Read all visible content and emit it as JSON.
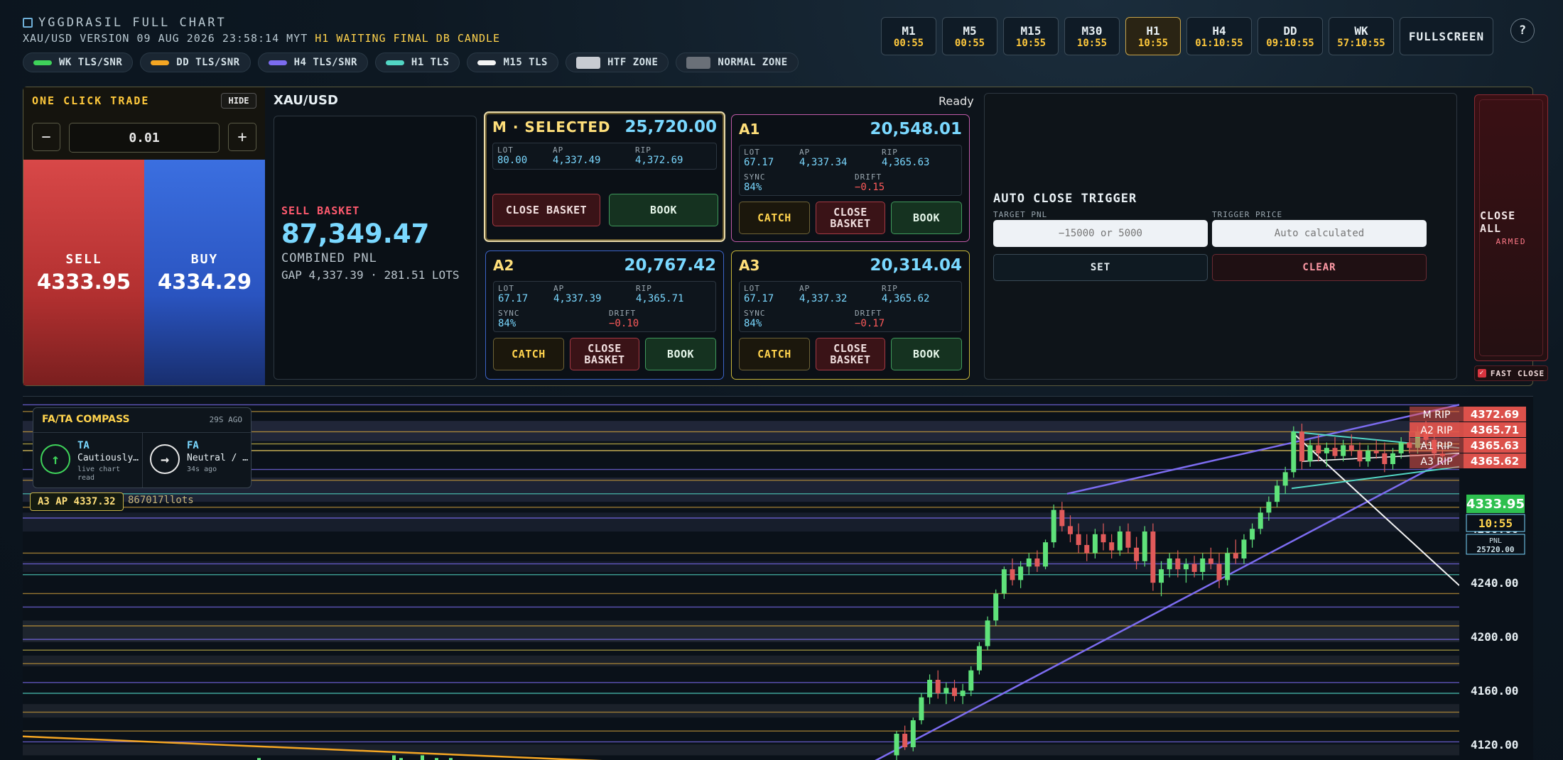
{
  "header": {
    "title": "YGGDRASIL FULL CHART",
    "sub_left": "XAU/USD VERSION 09 AUG 2026 23:58:14 MYT",
    "sub_highlight": "H1 WAITING FINAL DB CANDLE"
  },
  "legend": [
    {
      "label": "WK TLS/SNR",
      "color": "#3fd35a",
      "kind": "line"
    },
    {
      "label": "DD TLS/SNR",
      "color": "#f5a623",
      "kind": "line"
    },
    {
      "label": "H4 TLS/SNR",
      "color": "#7c6cf0",
      "kind": "line"
    },
    {
      "label": "H1 TLS",
      "color": "#52d6c4",
      "kind": "line"
    },
    {
      "label": "M15 TLS",
      "color": "#f4f4f4",
      "kind": "line"
    },
    {
      "label": "HTF ZONE",
      "color": "#c8ccd2",
      "kind": "box"
    },
    {
      "label": "NORMAL ZONE",
      "color": "#6a7078",
      "kind": "box"
    }
  ],
  "timeframes": [
    {
      "name": "M1",
      "timer": "00:55",
      "active": false
    },
    {
      "name": "M5",
      "timer": "00:55",
      "active": false
    },
    {
      "name": "M15",
      "timer": "10:55",
      "active": false
    },
    {
      "name": "M30",
      "timer": "10:55",
      "active": false
    },
    {
      "name": "H1",
      "timer": "10:55",
      "active": true
    },
    {
      "name": "H4",
      "timer": "01:10:55",
      "active": false
    },
    {
      "name": "DD",
      "timer": "09:10:55",
      "active": false
    },
    {
      "name": "WK",
      "timer": "57:10:55",
      "active": false
    }
  ],
  "fullscreen_label": "FULLSCREEN",
  "help_label": "?",
  "oct": {
    "title": "ONE CLICK TRADE",
    "hide_label": "HIDE",
    "minus": "−",
    "plus": "+",
    "lot": "0.01",
    "sell_label": "SELL",
    "sell_price": "4333.95",
    "buy_label": "BUY",
    "buy_price": "4334.29"
  },
  "symbol": "XAU/USD",
  "status": "Ready",
  "sell_basket": {
    "label": "SELL BASKET",
    "value": "87,349.47",
    "combined": "COMBINED PNL",
    "gap": "GAP 4,337.39 · 281.51 LOTS"
  },
  "accounts": {
    "m": {
      "name": "M · SELECTED",
      "value": "25,720.00",
      "lot": "80.00",
      "ap": "4,337.49",
      "rip": "4,372.69"
    },
    "a1": {
      "name": "A1",
      "value": "20,548.01",
      "lot": "67.17",
      "ap": "4,337.34",
      "rip": "4,365.63",
      "sync": "84%",
      "drift": "−0.15"
    },
    "a2": {
      "name": "A2",
      "value": "20,767.42",
      "lot": "67.17",
      "ap": "4,337.39",
      "rip": "4,365.71",
      "sync": "84%",
      "drift": "−0.10"
    },
    "a3": {
      "name": "A3",
      "value": "20,314.04",
      "lot": "67.17",
      "ap": "4,337.32",
      "rip": "4,365.62",
      "sync": "84%",
      "drift": "−0.17"
    }
  },
  "labels": {
    "lot": "LOT",
    "ap": "AP",
    "rip": "RIP",
    "sync": "SYNC",
    "drift": "DRIFT",
    "close_basket": "CLOSE BASKET",
    "close_basket_2l": "CLOSE\nBASKET",
    "book": "BOOK",
    "catch": "CATCH"
  },
  "auto_close": {
    "title": "AUTO CLOSE TRIGGER",
    "target_label": "TARGET PNL",
    "target_placeholder": "−15000 or 5000",
    "trigger_label": "TRIGGER PRICE",
    "trigger_placeholder": "Auto calculated",
    "set_label": "SET",
    "clear_label": "CLEAR"
  },
  "close_all": {
    "label": "CLOSE ALL",
    "state": "ARMED",
    "fast_label": "FAST CLOSE",
    "check": "✓"
  },
  "compass": {
    "title": "FA/TA COMPASS",
    "ago": "29S AGO",
    "ta": {
      "name": "TA",
      "value": "Cautiously…",
      "note": "live chart read",
      "icon": "↑"
    },
    "fa": {
      "name": "FA",
      "value": "Neutral / …",
      "note": "34s ago",
      "icon": "→"
    }
  },
  "ap_label": "A3 AP 4337.32",
  "ap_lots": "867017llots",
  "chart_data": {
    "type": "candlestick",
    "symbol": "XAU/USD",
    "timeframe": "H1",
    "y_ticks": [
      4120,
      4160,
      4200,
      4240,
      4280
    ],
    "ylim": [
      4108,
      4378
    ],
    "current_price": "4333.95",
    "countdown": "10:55",
    "pnl_label": "PNL",
    "pnl_value": "25720.00",
    "rip_markers": [
      {
        "label": "M RIP",
        "price": "4372.69"
      },
      {
        "label": "A2 RIP",
        "price": "4365.71"
      },
      {
        "label": "A1 RIP",
        "price": "4365.63"
      },
      {
        "label": "A3 RIP",
        "price": "4365.62"
      }
    ],
    "candles": [
      [
        4112,
        4130,
        4106,
        4128
      ],
      [
        4128,
        4134,
        4116,
        4118
      ],
      [
        4118,
        4140,
        4115,
        4138
      ],
      [
        4138,
        4158,
        4135,
        4155
      ],
      [
        4155,
        4172,
        4150,
        4168
      ],
      [
        4168,
        4175,
        4154,
        4158
      ],
      [
        4158,
        4166,
        4150,
        4162
      ],
      [
        4162,
        4168,
        4152,
        4156
      ],
      [
        4156,
        4165,
        4150,
        4160
      ],
      [
        4160,
        4178,
        4156,
        4175
      ],
      [
        4175,
        4196,
        4172,
        4193
      ],
      [
        4193,
        4215,
        4190,
        4212
      ],
      [
        4212,
        4235,
        4208,
        4232
      ],
      [
        4232,
        4252,
        4228,
        4250
      ],
      [
        4250,
        4258,
        4238,
        4242
      ],
      [
        4242,
        4256,
        4236,
        4252
      ],
      [
        4252,
        4262,
        4246,
        4258
      ],
      [
        4258,
        4264,
        4248,
        4252
      ],
      [
        4252,
        4272,
        4250,
        4270
      ],
      [
        4270,
        4298,
        4266,
        4294
      ],
      [
        4294,
        4300,
        4278,
        4282
      ],
      [
        4282,
        4290,
        4270,
        4276
      ],
      [
        4276,
        4284,
        4262,
        4268
      ],
      [
        4268,
        4276,
        4256,
        4262
      ],
      [
        4262,
        4280,
        4258,
        4276
      ],
      [
        4276,
        4284,
        4264,
        4270
      ],
      [
        4270,
        4276,
        4258,
        4264
      ],
      [
        4264,
        4282,
        4260,
        4278
      ],
      [
        4278,
        4284,
        4262,
        4266
      ],
      [
        4266,
        4274,
        4250,
        4256
      ],
      [
        4256,
        4282,
        4252,
        4278
      ],
      [
        4278,
        4284,
        4234,
        4240
      ],
      [
        4240,
        4256,
        4230,
        4250
      ],
      [
        4250,
        4262,
        4244,
        4258
      ],
      [
        4258,
        4264,
        4244,
        4250
      ],
      [
        4250,
        4258,
        4240,
        4254
      ],
      [
        4254,
        4260,
        4244,
        4248
      ],
      [
        4248,
        4262,
        4242,
        4258
      ],
      [
        4258,
        4266,
        4250,
        4254
      ],
      [
        4254,
        4262,
        4236,
        4242
      ],
      [
        4242,
        4266,
        4238,
        4262
      ],
      [
        4262,
        4272,
        4254,
        4258
      ],
      [
        4258,
        4276,
        4254,
        4272
      ],
      [
        4272,
        4284,
        4266,
        4280
      ],
      [
        4280,
        4296,
        4276,
        4292
      ],
      [
        4292,
        4304,
        4286,
        4300
      ],
      [
        4300,
        4316,
        4296,
        4312
      ],
      [
        4312,
        4326,
        4306,
        4322
      ],
      [
        4322,
        4356,
        4318,
        4352
      ],
      [
        4352,
        4358,
        4324,
        4330
      ],
      [
        4330,
        4346,
        4326,
        4342
      ],
      [
        4342,
        4350,
        4330,
        4336
      ],
      [
        4336,
        4344,
        4326,
        4340
      ],
      [
        4340,
        4348,
        4332,
        4334
      ],
      [
        4334,
        4346,
        4330,
        4342
      ],
      [
        4342,
        4350,
        4334,
        4338
      ],
      [
        4338,
        4344,
        4326,
        4330
      ],
      [
        4330,
        4342,
        4326,
        4338
      ],
      [
        4338,
        4346,
        4332,
        4336
      ],
      [
        4336,
        4344,
        4322,
        4328
      ],
      [
        4328,
        4340,
        4324,
        4336
      ],
      [
        4336,
        4348,
        4332,
        4344
      ],
      [
        4344,
        4352,
        4336,
        4340
      ],
      [
        4340,
        4356,
        4336,
        4352
      ],
      [
        4352,
        4360,
        4340,
        4346
      ],
      [
        4346,
        4350,
        4332,
        4336
      ],
      [
        4336,
        4342,
        4330,
        4334
      ]
    ]
  }
}
